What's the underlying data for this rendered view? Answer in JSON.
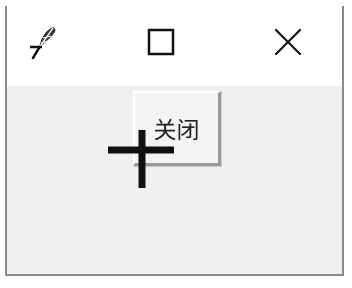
{
  "window": {
    "titlebar": {
      "app_icon": "feather-icon",
      "maximize_icon": "maximize-icon",
      "close_icon": "close-icon"
    },
    "content": {
      "close_button_label": "关闭"
    }
  },
  "cursor": {
    "icon": "crosshair-cursor-icon"
  }
}
